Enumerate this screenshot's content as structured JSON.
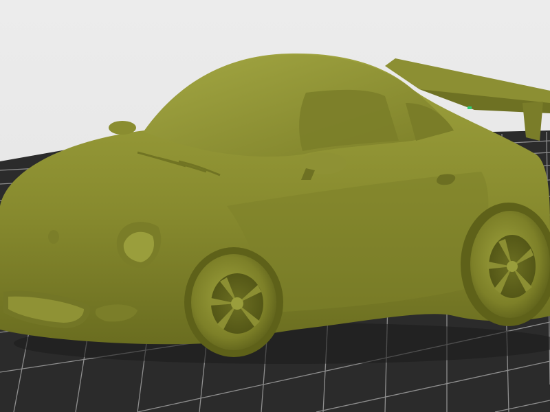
{
  "viewport": {
    "scene": "3d-print-preview",
    "build_plate_color": "#2b2b2b",
    "build_plate_grid_color": "#9a9a9a",
    "model_color": "#8c8f33",
    "model_shadow_color": "#5e6119",
    "model_highlight_color": "#b0b24e",
    "background_color": "#e6e6e6",
    "axis_marker_color": "#2ecc71"
  }
}
